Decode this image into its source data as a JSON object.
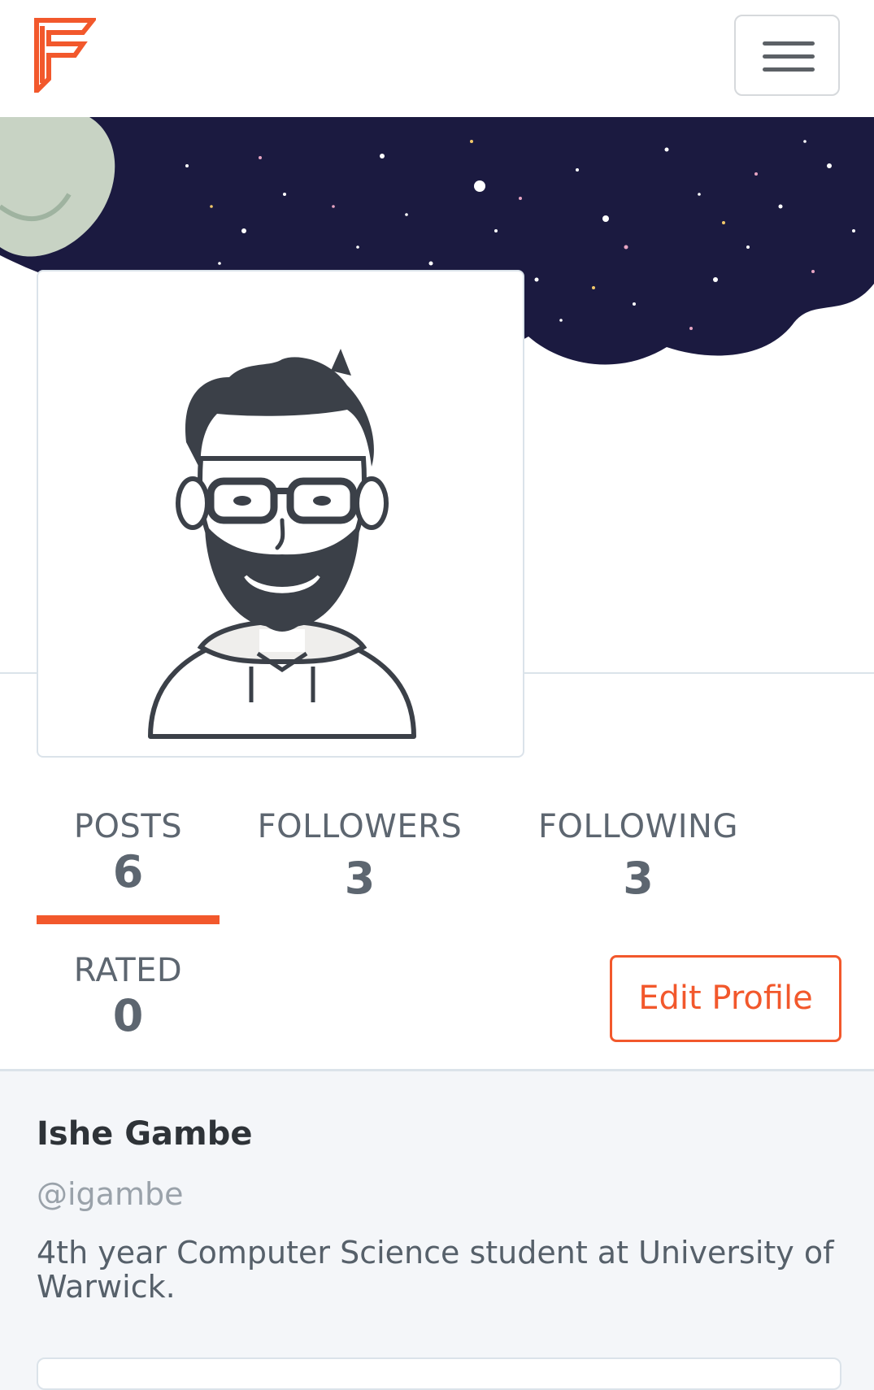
{
  "nav": {
    "logo_icon": "brand-f-logo",
    "menu_icon": "hamburger-menu-icon",
    "accent": "#f2582c"
  },
  "profile": {
    "name": "Ishe Gambe",
    "handle": "@igambe",
    "bio": "4th year Computer Science student at University of Warwick."
  },
  "stats": {
    "posts": {
      "label": "POSTS",
      "value": "6"
    },
    "followers": {
      "label": "FOLLOWERS",
      "value": "3"
    },
    "following": {
      "label": "FOLLOWING",
      "value": "3"
    },
    "rated": {
      "label": "RATED",
      "value": "0"
    }
  },
  "actions": {
    "edit_profile": "Edit Profile"
  }
}
